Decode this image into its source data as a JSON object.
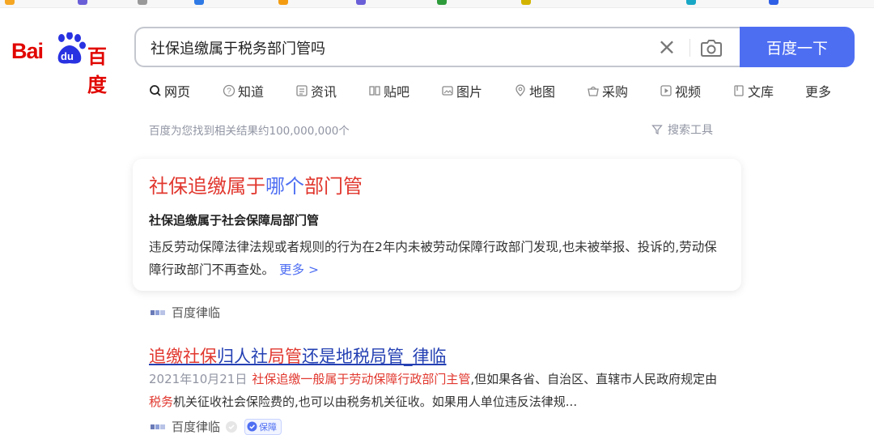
{
  "search": {
    "query": "社保追缴属于税务部门管吗",
    "submit_label": "百度一下"
  },
  "logo": {
    "text_latin": "Bai",
    "text_du": "du",
    "text_cn": "百度"
  },
  "tabs": [
    {
      "label": "网页",
      "icon": "search-icon"
    },
    {
      "label": "知道",
      "icon": "question-icon"
    },
    {
      "label": "资讯",
      "icon": "news-icon"
    },
    {
      "label": "贴吧",
      "icon": "tieba-icon"
    },
    {
      "label": "图片",
      "icon": "image-icon"
    },
    {
      "label": "地图",
      "icon": "map-pin-icon"
    },
    {
      "label": "采购",
      "icon": "basket-icon"
    },
    {
      "label": "视频",
      "icon": "play-icon"
    },
    {
      "label": "文库",
      "icon": "document-icon"
    },
    {
      "label": "更多",
      "icon": ""
    }
  ],
  "stats_text": "百度为您找到相关结果约100,000,000个",
  "tools_label": "搜索工具",
  "answer_card": {
    "title_part1": "社保追缴属于",
    "title_part2": "哪个",
    "title_part3": "部门管",
    "subtitle": "社保追缴属于社会保障局部门管",
    "body": "违反劳动保障法律法规或者规则的行为在2年内未被劳动保障行政部门发现,也未被举报、投诉的,劳动保障行政部门不再查处。",
    "more_label": "更多 >",
    "source": "百度律临"
  },
  "result2": {
    "title_part1": "追缴社保",
    "title_part2": "归人社",
    "title_part3": "局管",
    "title_part4": "还是地税局管_律临",
    "date": "2021年10月21日",
    "body_highlight1": "社保追缴一般属于劳动保障行政部门主管",
    "body_part2": ",但如果各省、自治区、直辖市人民政府规定由",
    "body_highlight2": "税务",
    "body_part3": "机关征收社会保险费的,也可以由税务机关征收。如果用人单位违反法律规...",
    "source": "百度律临",
    "badge": "保障"
  },
  "colors": {
    "brand_blue": "#4e6ef2",
    "brand_red": "#e10601",
    "highlight_red": "#e1372e",
    "link_blue": "#2440b3",
    "muted_gray": "#9195a3"
  }
}
